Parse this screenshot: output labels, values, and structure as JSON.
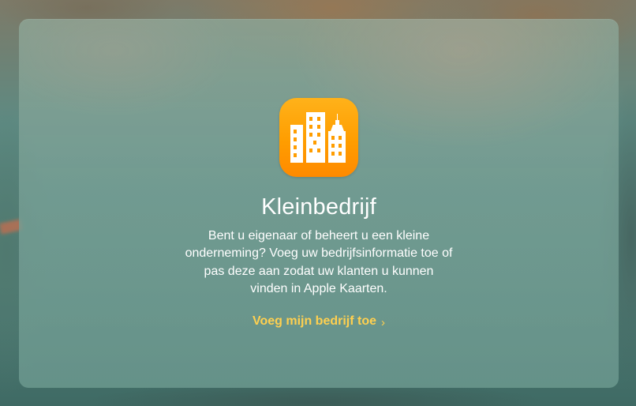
{
  "card": {
    "icon": "buildings-icon",
    "title": "Kleinbedrijf",
    "description": "Bent u eigenaar of beheert u een kleine onderneming? Voeg uw bedrijfsinformatie toe of pas deze aan zodat uw klanten u kunnen vinden in Apple Kaarten.",
    "cta_label": "Voeg mijn bedrijf toe",
    "cta_icon": "chevron-right-icon"
  },
  "colors": {
    "icon_gradient_top": "#ffb21a",
    "icon_gradient_bottom": "#ff8a00",
    "cta": "#ffd050",
    "text": "#ffffff"
  }
}
